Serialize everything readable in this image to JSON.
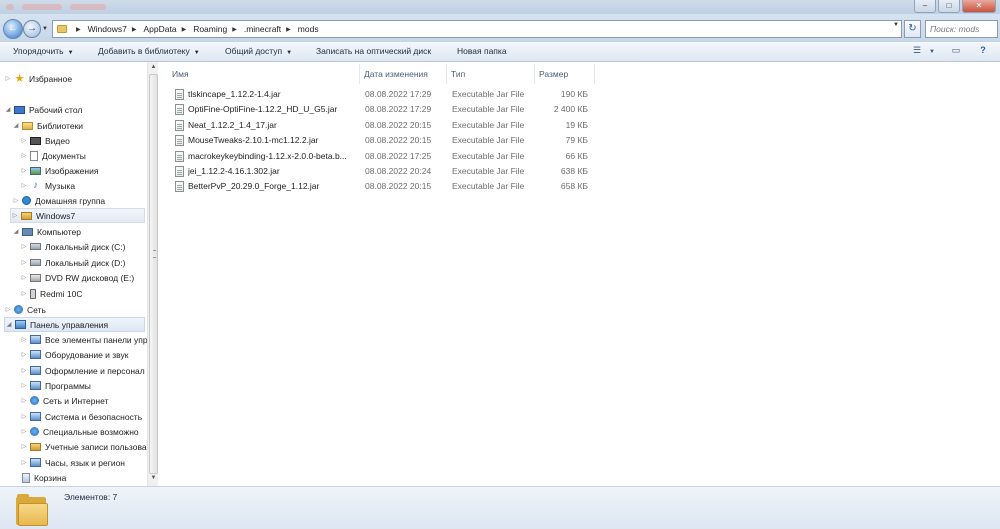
{
  "address": {
    "crumbs": [
      "Windows7",
      "AppData",
      "Roaming",
      ".minecraft",
      "mods"
    ],
    "search_placeholder": "Поиск: mods"
  },
  "toolbar": {
    "organize": "Упорядочить",
    "add_to_library": "Добавить в библиотеку",
    "share": "Общий доступ",
    "burn": "Записать на оптический диск",
    "new_folder": "Новая папка"
  },
  "nav": {
    "favorites": "Избранное",
    "desktop": "Рабочий стол",
    "libraries": "Библиотеки",
    "video": "Видео",
    "documents": "Документы",
    "images": "Изображения",
    "music": "Музыка",
    "homegroup": "Домашняя группа",
    "user": "Windows7",
    "computer": "Компьютер",
    "drive_c": "Локальный диск (C:)",
    "drive_d": "Локальный диск (D:)",
    "dvd": "DVD RW дисковод (E:)",
    "phone": "Redmi 10C",
    "network": "Сеть",
    "control_panel": "Панель управления",
    "cp_all": "Все элементы панели упр",
    "cp_hardware": "Оборудование и звук",
    "cp_appearance": "Оформление и персонал",
    "cp_programs": "Программы",
    "cp_network": "Сеть и Интернет",
    "cp_system": "Система и безопасность",
    "cp_access": "Специальные возможно",
    "cp_accounts": "Учетные записи пользова",
    "cp_clock": "Часы, язык и регион",
    "recycle": "Корзина"
  },
  "columns": {
    "name": "Имя",
    "date": "Дата изменения",
    "type": "Тип",
    "size": "Размер"
  },
  "files": [
    {
      "name": "tlskincape_1.12.2-1.4.jar",
      "date": "08.08.2022 17:29",
      "type": "Executable Jar File",
      "size": "190 КБ"
    },
    {
      "name": "OptiFine-OptiFine-1.12.2_HD_U_G5.jar",
      "date": "08.08.2022 17:29",
      "type": "Executable Jar File",
      "size": "2 400 КБ"
    },
    {
      "name": "Neat_1.12.2_1.4_17.jar",
      "date": "08.08.2022 20:15",
      "type": "Executable Jar File",
      "size": "19 КБ"
    },
    {
      "name": "MouseTweaks-2.10.1-mc1.12.2.jar",
      "date": "08.08.2022 20:15",
      "type": "Executable Jar File",
      "size": "79 КБ"
    },
    {
      "name": "macrokeykeybinding-1.12.x-2.0.0-beta.b...",
      "date": "08.08.2022 17:25",
      "type": "Executable Jar File",
      "size": "66 КБ"
    },
    {
      "name": "jei_1.12.2-4.16.1.302.jar",
      "date": "08.08.2022 20:24",
      "type": "Executable Jar File",
      "size": "638 КБ"
    },
    {
      "name": "BetterPvP_20.29.0_Forge_1.12.jar",
      "date": "08.08.2022 20:15",
      "type": "Executable Jar File",
      "size": "658 КБ"
    }
  ],
  "status": {
    "item_count": "Элементов: 7"
  }
}
